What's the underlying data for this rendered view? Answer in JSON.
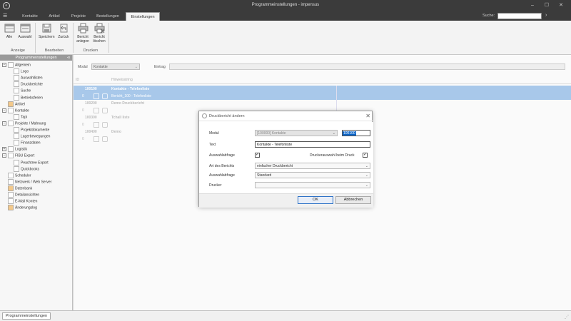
{
  "window": {
    "title": "Programmeinstellungen - impensus",
    "minimize": "–",
    "maximize": "☐",
    "close": "✕"
  },
  "menu": {
    "toggle": "☰",
    "tabs": [
      "Kontakte",
      "Artikel",
      "Projekte",
      "Bestellungen",
      "Einstellungen"
    ],
    "active_tab": "Einstellungen",
    "search_label": "Suche:",
    "search_value": "",
    "search_go": "›"
  },
  "ribbon": {
    "buttons": [
      {
        "label": "Alle",
        "icon": "view-all-icon"
      },
      {
        "label": "Auswahl",
        "icon": "view-selection-icon"
      },
      {
        "label": "Speichern",
        "icon": "save-icon"
      },
      {
        "label": "Zurück",
        "icon": "undo-icon"
      },
      {
        "label": "Bericht anlegen",
        "label_l1": "Bericht",
        "label_l2": "anlegen",
        "icon": "printer-add-icon"
      },
      {
        "label": "Bericht löschen",
        "label_l1": "Bericht",
        "label_l2": "löschen",
        "icon": "printer-delete-icon"
      }
    ],
    "groups": [
      "Anzeige",
      "Bearbeiten",
      "Drucken"
    ]
  },
  "sidebar": {
    "title": "Programmeinstellungen",
    "pin": "⊲",
    "items": [
      {
        "label": "Allgemein",
        "level": 0,
        "expander": "−"
      },
      {
        "label": "Logo",
        "level": 1
      },
      {
        "label": "Auswahllisten",
        "level": 1
      },
      {
        "label": "Druckberichte",
        "level": 1
      },
      {
        "label": "Suche",
        "level": 1
      },
      {
        "label": "Betriebsferien",
        "level": 1
      },
      {
        "label": "Artikel",
        "level": 0
      },
      {
        "label": "Kontakte",
        "level": 0,
        "expander": "−"
      },
      {
        "label": "Tapi",
        "level": 1
      },
      {
        "label": "Projekte / Mahnung",
        "level": 0,
        "expander": "−"
      },
      {
        "label": "Projektdokumente",
        "level": 1
      },
      {
        "label": "Lagerbewegungen",
        "level": 1
      },
      {
        "label": "Finanzdaten",
        "level": 1
      },
      {
        "label": "Logistik",
        "level": 0,
        "expander": "+"
      },
      {
        "label": "FIBU Export",
        "level": 0,
        "expander": "−"
      },
      {
        "label": "Peachtree Export",
        "level": 1
      },
      {
        "label": "Quickbooks",
        "level": 1
      },
      {
        "label": "Scheduler",
        "level": 0
      },
      {
        "label": "Netzwerk / Web Server",
        "level": 0
      },
      {
        "label": "Datenbank",
        "level": 0
      },
      {
        "label": "Detailansichten",
        "level": 0
      },
      {
        "label": "E-Mail Konten",
        "level": 0
      },
      {
        "label": "Änderungslog",
        "level": 0
      }
    ]
  },
  "filter": {
    "modul_label": "Modul",
    "modul_value": "Kontakte",
    "eintrag_label": "Eintrag",
    "eintrag_value": ""
  },
  "grid": {
    "headers": [
      "ID",
      "Hinweisstring"
    ],
    "rows": [
      {
        "type": "group",
        "id": "100100",
        "text": "Kontakte - Telefonliste",
        "selected": true
      },
      {
        "type": "detail",
        "num": "0",
        "text": "Bericht_100 - Telefonliste",
        "selected": true
      },
      {
        "type": "group",
        "id": "100200",
        "text": "Demo Druckbericht",
        "selected": false
      },
      {
        "type": "detail",
        "num": "0",
        "text": "",
        "selected": false
      },
      {
        "type": "group",
        "id": "100300",
        "text": "Tchall liste",
        "selected": false
      },
      {
        "type": "detail",
        "num": "0",
        "text": "",
        "selected": false
      },
      {
        "type": "group",
        "id": "100400",
        "text": "Demo",
        "selected": false
      },
      {
        "type": "detail",
        "num": "0",
        "text": "",
        "selected": false
      }
    ]
  },
  "dialog": {
    "title": "Druckbericht ändern",
    "close": "✕",
    "modul_label": "Modul",
    "modul_value": "[100000] Kontakte",
    "id_value": "100100",
    "text_label": "Text",
    "text_value": "Kontakte - Telefonliste",
    "auswahlabfrage_label": "Auswahlabfrage",
    "auswahlabfrage_checked": "✓",
    "druckerauswahl_label": "Druckerauswahl beim Druck",
    "druckerauswahl_checked": "✓",
    "art_label": "Art des Berichts",
    "art_value": "einfacher Druckbericht",
    "auswahl2_label": "Auswahlabfrage",
    "auswahl2_value": "Standard",
    "drucker_label": "Drucker",
    "drucker_value": "",
    "dropdown_arrow": "⌄",
    "ok": "OK",
    "cancel": "Abbrechen"
  },
  "status": {
    "tab": "Programmeinstellungen",
    "grip": "⋰"
  }
}
